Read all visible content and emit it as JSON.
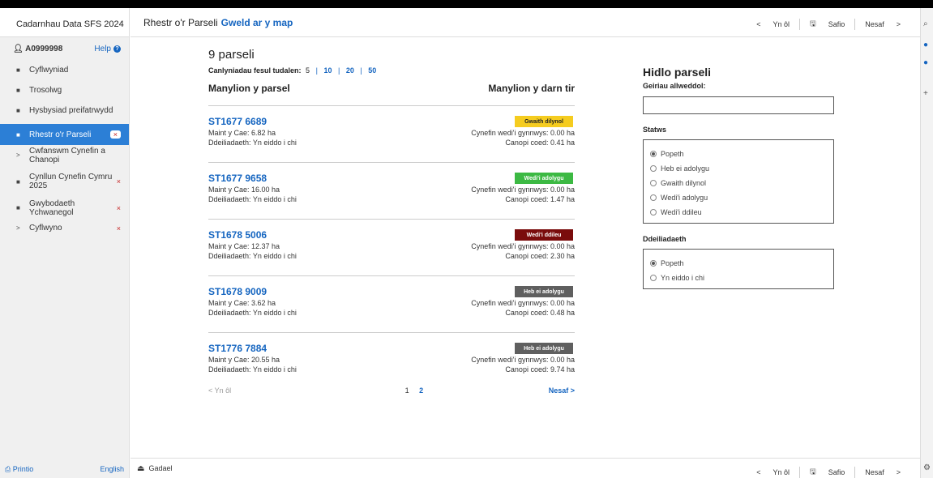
{
  "sidebar": {
    "title": "Cadarnhau Data SFS 2024",
    "user": "A0999998",
    "help": "Help",
    "items": [
      {
        "label": "Cyflwyniad",
        "icon": "doc-icon",
        "x": ""
      },
      {
        "label": "Trosolwg",
        "icon": "doc-icon",
        "x": ""
      },
      {
        "label": "Hysbysiad preifatrwydd",
        "icon": "doc-icon",
        "x": ""
      },
      {
        "label": "Rhestr o'r Parseli",
        "icon": "doc-icon",
        "x": "×"
      },
      {
        "label": "Cwfanswm Cynefin a Chanopi",
        "icon": "chevron-right-icon",
        "x": ""
      },
      {
        "label": "Cynllun Cynefin Cymru 2025",
        "icon": "doc-icon",
        "x": "×"
      },
      {
        "label": "Gwybodaeth Ychwanegol",
        "icon": "doc-icon",
        "x": "×"
      },
      {
        "label": "Cyflwyno",
        "icon": "chevron-right-icon",
        "x": "×"
      }
    ],
    "print": "Printio",
    "language": "English"
  },
  "header": {
    "title": "Rhestr o'r Parseli",
    "map_link": "Gweld ar y map",
    "back": "Yn ôl",
    "save": "Safio",
    "next": "Nesaf"
  },
  "list": {
    "count": "9 parseli",
    "per_page_label": "Canlyniadau fesul tudalen:",
    "per_page_current": "5",
    "per_page_options": [
      "10",
      "20",
      "50"
    ],
    "col_left": "Manylion y parsel",
    "col_right": "Manylion y darn tir",
    "parcels": [
      {
        "id": "ST1677 6689",
        "status": "Gwaith dilynol",
        "badge_bg": "#f5cc1f",
        "badge_fg": "#222",
        "size": "Maint y Cae: 6.82 ha",
        "owner": "Ddeiliadaeth: Yn eiddo i chi",
        "habitat": "Cynefin wedi'i gynnwys: 0.00 ha",
        "canopy": "Canopi coed: 0.41 ha"
      },
      {
        "id": "ST1677 9658",
        "status": "Wedi'i adolygu",
        "badge_bg": "#3cb943",
        "badge_fg": "#fff",
        "size": "Maint y Cae: 16.00 ha",
        "owner": "Ddeiliadaeth: Yn eiddo i chi",
        "habitat": "Cynefin wedi'i gynnwys: 0.00 ha",
        "canopy": "Canopi coed: 1.47 ha"
      },
      {
        "id": "ST1678 5006",
        "status": "Wedi'i ddileu",
        "badge_bg": "#7a0c0c",
        "badge_fg": "#fff",
        "size": "Maint y Cae: 12.37 ha",
        "owner": "Ddeiliadaeth: Yn eiddo i chi",
        "habitat": "Cynefin wedi'i gynnwys: 0.00 ha",
        "canopy": "Canopi coed: 2.30 ha"
      },
      {
        "id": "ST1678 9009",
        "status": "Heb ei adolygu",
        "badge_bg": "#5f5f5f",
        "badge_fg": "#fff",
        "size": "Maint y Cae: 3.62 ha",
        "owner": "Ddeiliadaeth: Yn eiddo i chi",
        "habitat": "Cynefin wedi'i gynnwys: 0.00 ha",
        "canopy": "Canopi coed: 0.48 ha"
      },
      {
        "id": "ST1776 7884",
        "status": "Heb ei adolygu",
        "badge_bg": "#5f5f5f",
        "badge_fg": "#fff",
        "size": "Maint y Cae: 20.55 ha",
        "owner": "Ddeiliadaeth: Yn eiddo i chi",
        "habitat": "Cynefin wedi'i gynnwys: 0.00 ha",
        "canopy": "Canopi coed: 9.74 ha"
      }
    ],
    "pager": {
      "prev": "Yn ôl",
      "page1": "1",
      "page2": "2",
      "next": "Nesaf"
    }
  },
  "filter": {
    "title": "Hidlo parseli",
    "keywords_label": "Geiriau allweddol:",
    "status_label": "Statws",
    "status_options": [
      "Popeth",
      "Heb ei adolygu",
      "Gwaith dilynol",
      "Wedi'i adolygu",
      "Wedi'i ddileu"
    ],
    "tenure_label": "Ddeiliadaeth",
    "tenure_options": [
      "Popeth",
      "Yn eiddo i chi"
    ]
  },
  "footer": {
    "exit": "Gadael",
    "back": "Yn ôl",
    "save": "Safio",
    "next": "Nesaf"
  }
}
